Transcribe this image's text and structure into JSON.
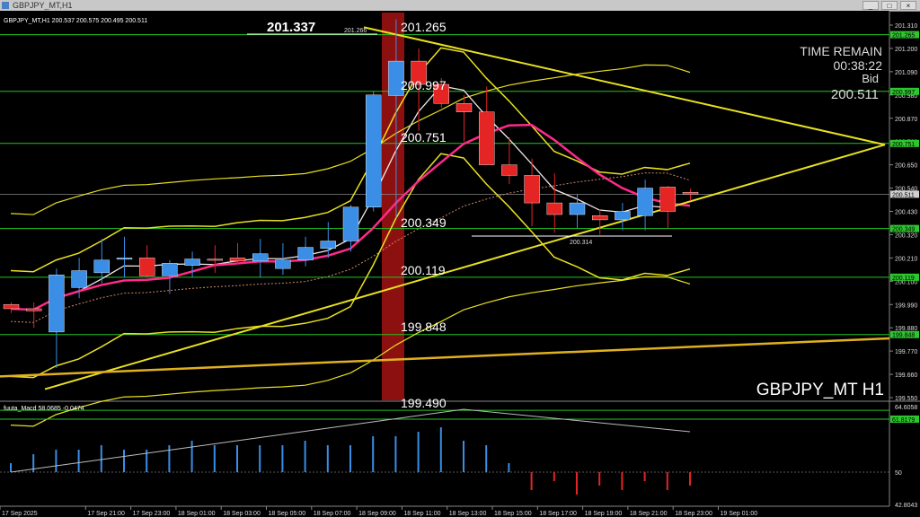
{
  "window": {
    "title": "GBPJPY_MT,H1",
    "buttons": [
      "_",
      "□",
      "×"
    ]
  },
  "header": {
    "symbol_info": "GBPJPY_MT,H1  200.537 200.575 200.495 200.511"
  },
  "info_panel": {
    "time_remain_label": "TIME REMAIN",
    "time_remain_value": "00:38:22",
    "bid_label": "Bid",
    "bid_value": "200.511"
  },
  "watermark": "GBPJPY_MT H1",
  "macd_header": "fuuta_Macd 58.0685  -0.0474",
  "price_axis": {
    "ticks": [
      "201.310",
      "201.200",
      "201.090",
      "200.980",
      "200.870",
      "200.760",
      "200.650",
      "200.540",
      "200.430",
      "200.320",
      "200.210",
      "200.100",
      "199.990",
      "199.880",
      "199.770",
      "199.660",
      "199.550"
    ],
    "tags": [
      {
        "value": "201.265",
        "color": "#2ec62e"
      },
      {
        "value": "200.997",
        "color": "#2ec62e"
      },
      {
        "value": "200.751",
        "color": "#2ec62e"
      },
      {
        "value": "200.511",
        "color": "#d0d0d0"
      },
      {
        "value": "200.349",
        "color": "#2ec62e"
      },
      {
        "value": "200.119",
        "color": "#2ec62e"
      },
      {
        "value": "199.848",
        "color": "#2ec62e"
      }
    ]
  },
  "levels": {
    "high_label": "201.337",
    "high_small": "201.266",
    "low_small": "200.314",
    "lines": [
      "201.265",
      "200.997",
      "200.751",
      "200.349",
      "200.119",
      "199.848",
      "199.490"
    ]
  },
  "time_axis": [
    "17 Sep 2025",
    "17 Sep 21:00",
    "17 Sep 23:00",
    "18 Sep 01:00",
    "18 Sep 03:00",
    "18 Sep 05:00",
    "18 Sep 07:00",
    "18 Sep 09:00",
    "18 Sep 11:00",
    "18 Sep 13:00",
    "18 Sep 15:00",
    "18 Sep 17:00",
    "18 Sep 19:00",
    "18 Sep 21:00",
    "18 Sep 23:00",
    "19 Sep 01:00"
  ],
  "macd_axis": {
    "ticks": [
      "64.6058",
      "61.8179",
      "50",
      "42.8043"
    ],
    "tag": {
      "value": "61.8179",
      "color": "#2ec62e"
    }
  },
  "colors": {
    "bull": "#3a8ee6",
    "bear": "#e52424",
    "level": "#22c422",
    "bands": "#e8e020",
    "ma_fast": "#ff2a8a",
    "highlight": "#8c1010"
  },
  "chart_data": {
    "type": "candlestick",
    "title": "GBPJPY_MT H1",
    "x": [
      "17 Sep 19:00",
      "17 Sep 20:00",
      "17 Sep 21:00",
      "17 Sep 22:00",
      "17 Sep 23:00",
      "18 Sep 00:00",
      "18 Sep 01:00",
      "18 Sep 02:00",
      "18 Sep 03:00",
      "18 Sep 04:00",
      "18 Sep 05:00",
      "18 Sep 06:00",
      "18 Sep 07:00",
      "18 Sep 08:00",
      "18 Sep 09:00",
      "18 Sep 10:00",
      "18 Sep 11:00",
      "18 Sep 12:00",
      "18 Sep 13:00",
      "18 Sep 14:00",
      "18 Sep 15:00",
      "18 Sep 16:00",
      "18 Sep 17:00",
      "18 Sep 18:00",
      "18 Sep 19:00",
      "18 Sep 20:00",
      "18 Sep 21:00",
      "18 Sep 22:00",
      "18 Sep 23:00",
      "19 Sep 00:00",
      "19 Sep 01:00"
    ],
    "open": [
      199.99,
      199.97,
      199.86,
      200.07,
      200.14,
      200.21,
      200.21,
      200.125,
      200.175,
      200.205,
      200.21,
      200.195,
      200.16,
      200.2,
      200.255,
      200.29,
      200.45,
      200.977,
      201.14,
      201.03,
      200.94,
      200.9,
      200.65,
      200.6,
      200.47,
      200.415,
      200.41,
      200.39,
      200.41,
      200.545,
      200.52
    ],
    "high": [
      200.0,
      200.0,
      200.16,
      200.21,
      200.3,
      200.31,
      200.27,
      200.2,
      200.24,
      200.27,
      200.28,
      200.3,
      200.28,
      200.31,
      200.38,
      200.46,
      201.0,
      201.337,
      201.2,
      201.06,
      200.98,
      201.02,
      200.78,
      200.68,
      200.61,
      200.51,
      200.44,
      200.47,
      200.58,
      200.55,
      200.537
    ],
    "low": [
      199.95,
      199.88,
      199.69,
      200.02,
      200.09,
      200.12,
      200.12,
      200.04,
      200.12,
      200.14,
      200.18,
      200.12,
      200.13,
      200.17,
      200.21,
      200.24,
      200.43,
      200.4,
      200.81,
      200.92,
      200.76,
      200.7,
      200.56,
      200.36,
      200.33,
      200.35,
      200.32,
      200.34,
      200.34,
      200.35,
      200.48
    ],
    "close": [
      199.97,
      199.96,
      200.13,
      200.15,
      200.2,
      200.21,
      200.125,
      200.185,
      200.205,
      200.2,
      200.195,
      200.23,
      200.2,
      200.26,
      200.29,
      200.45,
      200.98,
      201.14,
      201.03,
      200.94,
      200.9,
      200.65,
      200.6,
      200.47,
      200.415,
      200.47,
      200.39,
      200.43,
      200.54,
      200.43,
      200.511
    ],
    "macd_hist": [
      52,
      54,
      55,
      55,
      56,
      55,
      55,
      56,
      57,
      56,
      56,
      56,
      56,
      57,
      56,
      56,
      58,
      58,
      59,
      60,
      57,
      56,
      52,
      46,
      48,
      45,
      47,
      46,
      48,
      46,
      47
    ],
    "ylim": [
      199.55,
      201.33
    ],
    "macd_ylim": [
      42.8043,
      64.6058
    ]
  }
}
